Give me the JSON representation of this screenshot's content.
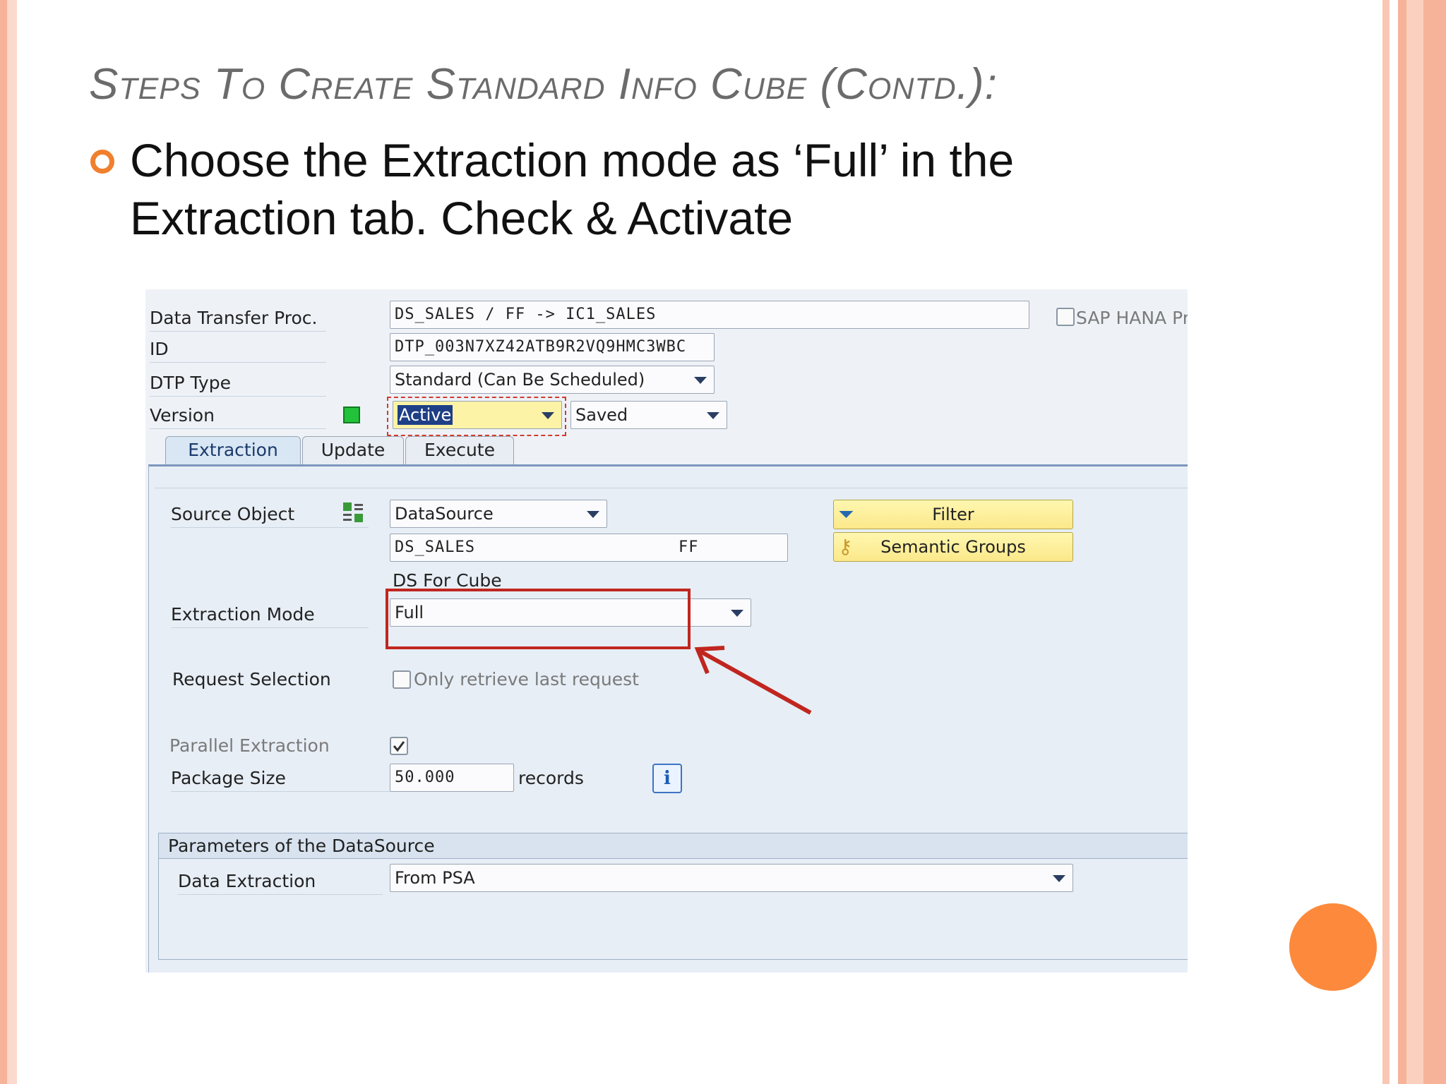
{
  "slide": {
    "title": "Steps To Create Standard Info Cube (Contd.):",
    "bullet": "Choose the Extraction mode as ‘Full’ in the Extraction tab. Check & Activate"
  },
  "sap": {
    "header": {
      "dtp_label": "Data Transfer Proc.",
      "dtp_value": "DS_SALES / FF -> IC1_SALES",
      "hana_label": "SAP HANA Pr",
      "id_label": "ID",
      "id_value": "DTP_003N7XZ42ATB9R2VQ9HMC3WBC",
      "dtp_type_label": "DTP Type",
      "dtp_type_value": "Standard (Can Be Scheduled)",
      "version_label": "Version",
      "version_value": "Active",
      "saved_value": "Saved"
    },
    "tabs": [
      "Extraction",
      "Update",
      "Execute"
    ],
    "extraction": {
      "source_object_label": "Source Object",
      "source_type_value": "DataSource",
      "source_name_value": "DS_SALES",
      "source_system_value": "FF",
      "source_desc": "DS For Cube",
      "filter_label": "Filter",
      "semantic_groups_label": "Semantic Groups",
      "extraction_mode_label": "Extraction Mode",
      "extraction_mode_value": "Full",
      "request_selection_label": "Request Selection",
      "only_last_request_label": "Only retrieve last request",
      "parallel_extraction_label": "Parallel Extraction",
      "package_size_label": "Package Size",
      "package_size_value": "50.000",
      "records_label": "records",
      "info_icon": "i"
    },
    "datasource_params": {
      "section_title": "Parameters of the DataSource",
      "data_extraction_label": "Data Extraction",
      "data_extraction_value": "From PSA"
    },
    "colors": {
      "highlight": "#c0261f",
      "active_status": "#22c33a",
      "accent_orange": "#fd8a3c"
    }
  }
}
